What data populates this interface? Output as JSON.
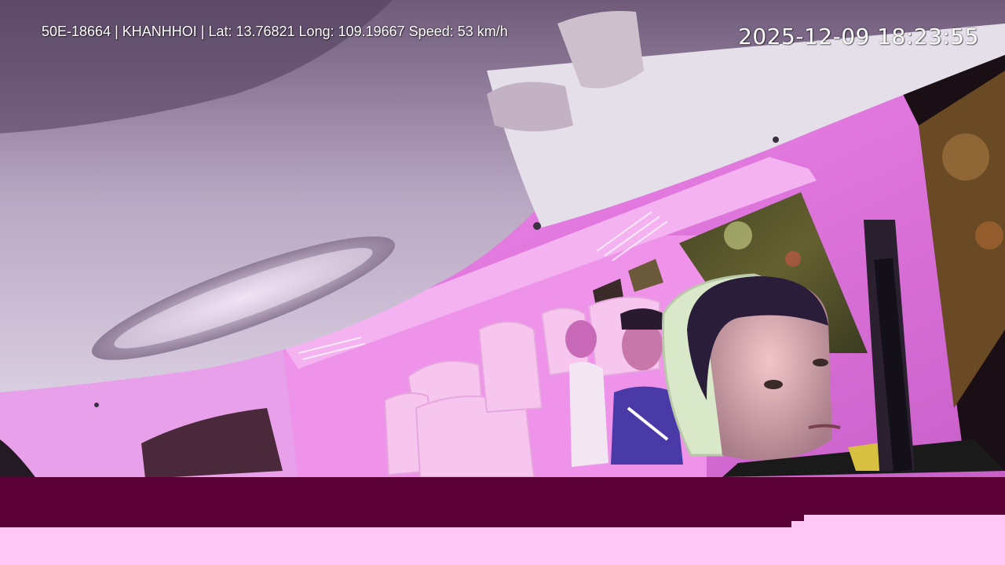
{
  "overlay": {
    "info_line": "50E-18664 | KHANHHOI | Lat: 13.76821 Long: 109.19667 Speed: 53 km/h",
    "timestamp": "2025-12-09 18:23:55"
  },
  "scene": {
    "description_icon": "dashcam-cabin-view",
    "colors": {
      "cabin_pink": "#e27ae0",
      "ceiling": "#cfc3d8",
      "bar_maroon": "#5c0238",
      "bar_light": "#ffc7f5"
    }
  }
}
